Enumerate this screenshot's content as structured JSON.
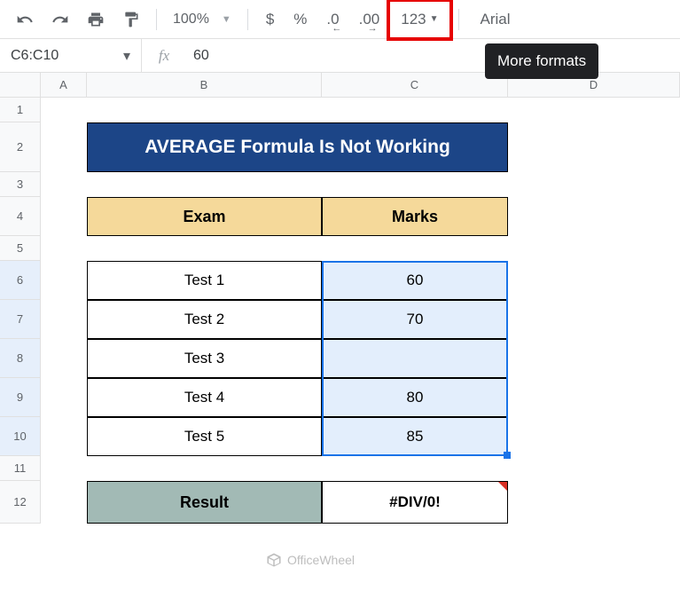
{
  "toolbar": {
    "zoom": "100%",
    "fmt_currency": "$",
    "fmt_percent": "%",
    "fmt_dec_dec": ".0",
    "fmt_dec_inc": ".00",
    "fmt_more": "123",
    "font": "Arial"
  },
  "tooltip": "More formats",
  "namebox": "C6:C10",
  "formula": "60",
  "columns": {
    "A": "A",
    "B": "B",
    "C": "C",
    "D": "D"
  },
  "rows": {
    "r1": "1",
    "r2": "2",
    "r3": "3",
    "r4": "4",
    "r5": "5",
    "r6": "6",
    "r7": "7",
    "r8": "8",
    "r9": "9",
    "r10": "10",
    "r11": "11",
    "r12": "12"
  },
  "sheet": {
    "title": "AVERAGE Formula Is Not Working",
    "header_exam": "Exam",
    "header_marks": "Marks",
    "rows": [
      {
        "exam": "Test 1",
        "marks": "60"
      },
      {
        "exam": "Test 2",
        "marks": "70"
      },
      {
        "exam": "Test 3",
        "marks": ""
      },
      {
        "exam": "Test 4",
        "marks": "80"
      },
      {
        "exam": "Test 5",
        "marks": "85"
      }
    ],
    "result_label": "Result",
    "result_value": "#DIV/0!"
  },
  "watermark": "OfficeWheel",
  "chart_data": {
    "type": "table",
    "title": "AVERAGE Formula Is Not Working",
    "columns": [
      "Exam",
      "Marks"
    ],
    "rows": [
      [
        "Test 1",
        60
      ],
      [
        "Test 2",
        70
      ],
      [
        "Test 3",
        null
      ],
      [
        "Test 4",
        80
      ],
      [
        "Test 5",
        85
      ]
    ],
    "result": "#DIV/0!"
  }
}
